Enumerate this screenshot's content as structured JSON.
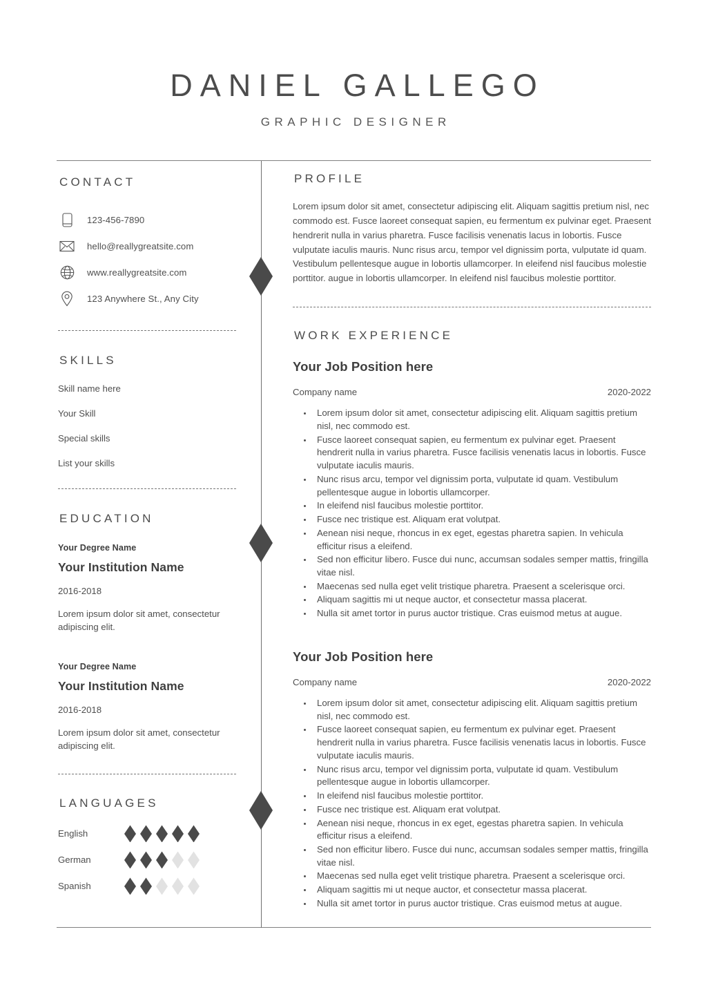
{
  "header": {
    "name": "DANIEL GALLEGO",
    "role": "GRAPHIC DESIGNER"
  },
  "colors": {
    "ink": "#4a4a4a",
    "rule": "#808080",
    "diamond_filled": "#4a4a4a",
    "diamond_empty": "#e2e2e2"
  },
  "contact": {
    "title": "CONTACT",
    "items": [
      {
        "icon": "phone-icon",
        "value": "123-456-7890"
      },
      {
        "icon": "envelope-icon",
        "value": "hello@reallygreatsite.com"
      },
      {
        "icon": "globe-icon",
        "value": "www.reallygreatsite.com"
      },
      {
        "icon": "location-pin-icon",
        "value": "123 Anywhere St., Any City"
      }
    ]
  },
  "skills": {
    "title": "SKILLS",
    "items": [
      "Skill name here",
      "Your Skill",
      "Special skills",
      "List your skills"
    ]
  },
  "education": {
    "title": "EDUCATION",
    "entries": [
      {
        "degree": "Your Degree Name",
        "institution": "Your Institution Name",
        "dates": "2016-2018",
        "description": "Lorem ipsum dolor sit amet, consectetur adipiscing elit."
      },
      {
        "degree": "Your Degree Name",
        "institution": "Your Institution Name",
        "dates": "2016-2018",
        "description": "Lorem ipsum dolor sit amet, consectetur adipiscing elit."
      }
    ]
  },
  "languages": {
    "title": "LANGUAGES",
    "max_level": 5,
    "items": [
      {
        "name": "English",
        "level": 5
      },
      {
        "name": "German",
        "level": 3
      },
      {
        "name": "Spanish",
        "level": 2
      }
    ]
  },
  "profile": {
    "title": "PROFILE",
    "text": "Lorem ipsum dolor sit amet, consectetur adipiscing elit. Aliquam sagittis pretium nisl, nec commodo est. Fusce laoreet consequat sapien, eu fermentum ex pulvinar eget. Praesent hendrerit nulla in varius pharetra. Fusce facilisis venenatis lacus in lobortis. Fusce vulputate iaculis mauris. Nunc risus arcu, tempor vel dignissim porta, vulputate id quam. Vestibulum pellentesque augue in lobortis ullamcorper. In eleifend nisl faucibus molestie porttitor.   augue in lobortis ullamcorper. In eleifend nisl faucibus molestie porttitor."
  },
  "work": {
    "title": "WORK EXPERIENCE",
    "jobs": [
      {
        "position": "Your Job Position here",
        "company": "Company name",
        "dates": "2020-2022",
        "bullets": [
          "Lorem ipsum dolor sit amet, consectetur adipiscing elit. Aliquam sagittis pretium nisl, nec commodo est.",
          "Fusce laoreet consequat sapien, eu fermentum ex pulvinar eget. Praesent hendrerit nulla in varius pharetra. Fusce facilisis venenatis lacus in lobortis. Fusce vulputate iaculis mauris.",
          "Nunc risus arcu, tempor vel dignissim porta, vulputate id quam. Vestibulum pellentesque augue in lobortis ullamcorper.",
          "In eleifend nisl faucibus molestie porttitor.",
          "Fusce nec tristique est. Aliquam erat volutpat.",
          "Aenean nisi neque, rhoncus in ex eget, egestas pharetra sapien. In vehicula efficitur risus a eleifend.",
          "Sed non efficitur libero. Fusce dui nunc, accumsan sodales semper mattis, fringilla vitae nisl.",
          "Maecenas sed nulla eget velit tristique pharetra. Praesent a scelerisque orci.",
          "Aliquam sagittis mi ut neque auctor, et consectetur massa placerat.",
          "Nulla sit amet tortor in purus auctor tristique. Cras euismod metus at augue."
        ]
      },
      {
        "position": "Your Job Position here",
        "company": "Company name",
        "dates": "2020-2022",
        "bullets": [
          "Lorem ipsum dolor sit amet, consectetur adipiscing elit. Aliquam sagittis pretium nisl, nec commodo est.",
          "Fusce laoreet consequat sapien, eu fermentum ex pulvinar eget. Praesent hendrerit nulla in varius pharetra. Fusce facilisis venenatis lacus in lobortis. Fusce vulputate iaculis mauris.",
          "Nunc risus arcu, tempor vel dignissim porta, vulputate id quam. Vestibulum pellentesque augue in lobortis ullamcorper.",
          "In eleifend nisl faucibus molestie porttitor.",
          "Fusce nec tristique est. Aliquam erat volutpat.",
          "Aenean nisi neque, rhoncus in ex eget, egestas pharetra sapien. In vehicula efficitur risus a eleifend.",
          "Sed non efficitur libero. Fusce dui nunc, accumsan sodales semper mattis, fringilla vitae nisl.",
          "Maecenas sed nulla eget velit tristique pharetra. Praesent a scelerisque orci.",
          "Aliquam sagittis mi ut neque auctor, et consectetur massa placerat.",
          "Nulla sit amet tortor in purus auctor tristique. Cras euismod metus at augue."
        ]
      }
    ]
  }
}
